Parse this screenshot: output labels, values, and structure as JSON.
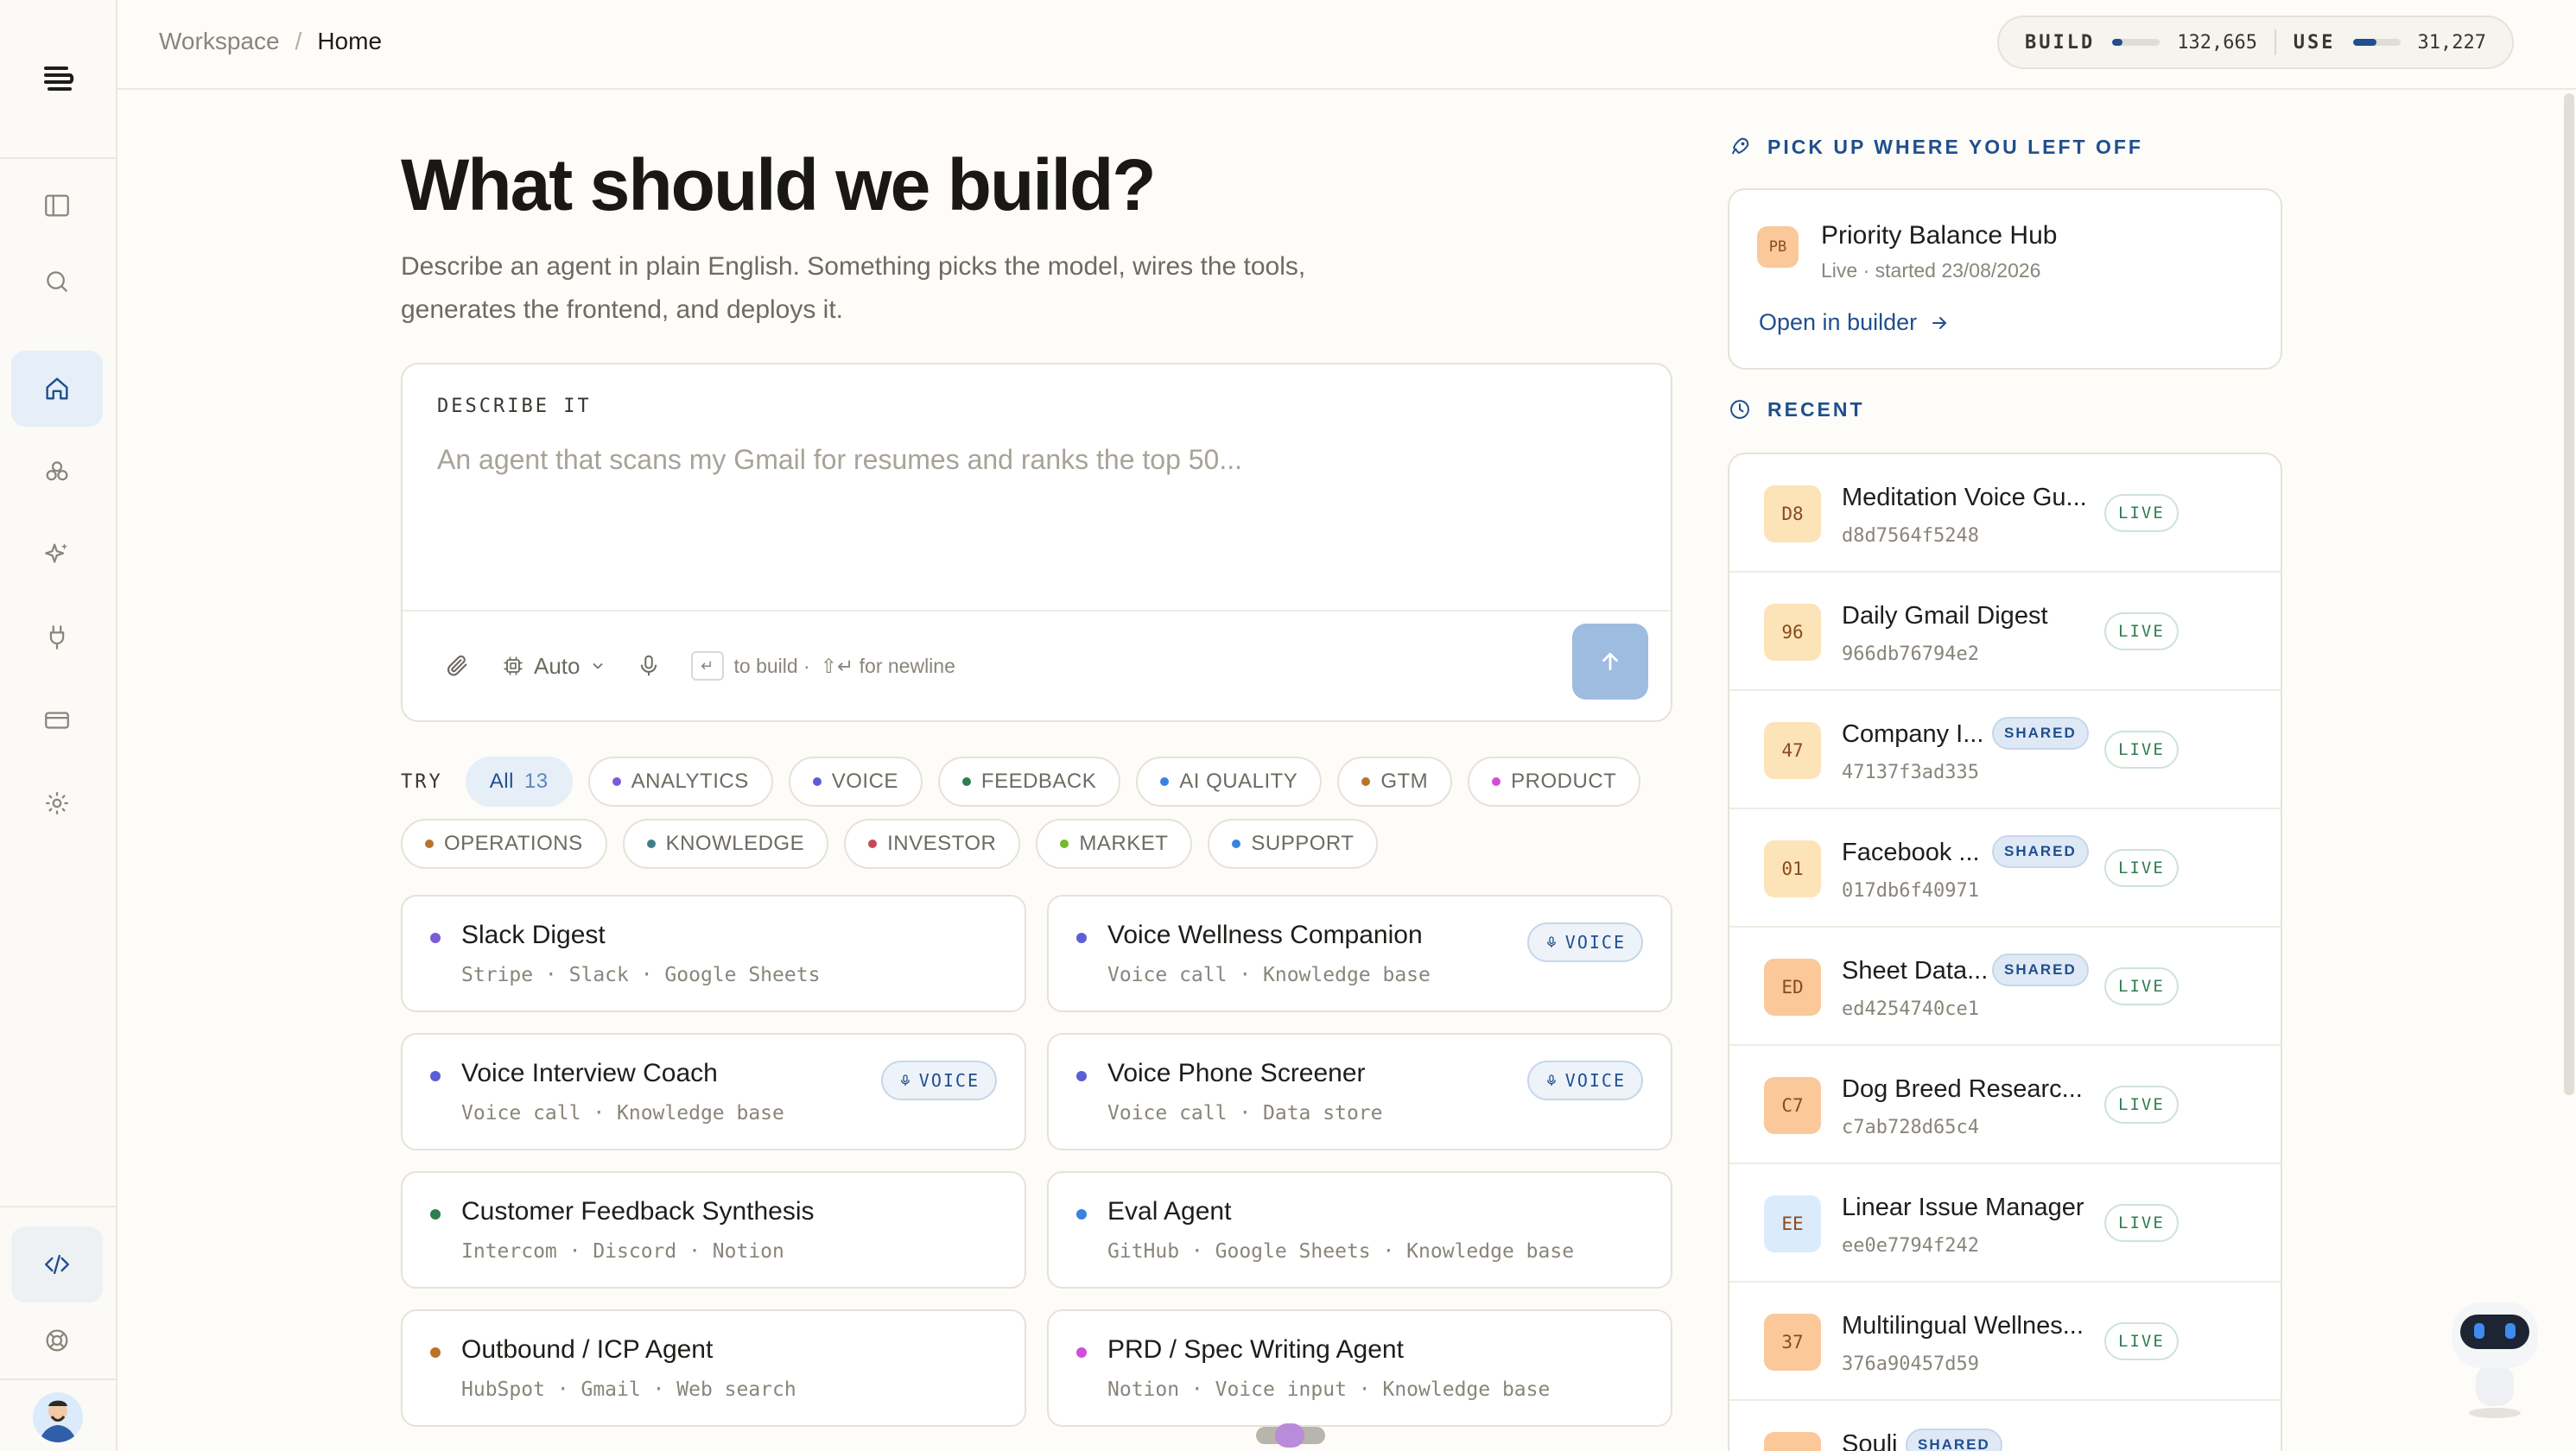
{
  "breadcrumb": {
    "root": "Workspace",
    "separator": "/",
    "current": "Home"
  },
  "usage": {
    "build_label": "BUILD",
    "build_value": "132,665",
    "build_fill": 0.22,
    "use_label": "USE",
    "use_value": "31,227",
    "use_fill": 0.5
  },
  "rail": {
    "items": [
      "sidebar-toggle-icon",
      "search-icon",
      "home-icon",
      "agents-icon",
      "sparkles-icon",
      "plug-icon",
      "billing-icon",
      "settings-icon"
    ],
    "bottom": [
      "code-icon",
      "help-icon",
      "avatar"
    ]
  },
  "hero": {
    "title": "What should we build?",
    "subtitle": "Describe an agent in plain English. Something picks the model, wires the tools, generates the frontend, and deploys it."
  },
  "composer": {
    "label": "DESCRIBE IT",
    "placeholder": "An agent that scans my Gmail for resumes and ranks the top 50...",
    "model": "Auto",
    "enter_key": "↵",
    "hint_build": "to build ·",
    "hint_newline": "⇧↵ for newline"
  },
  "try": {
    "label": "TRY",
    "chips": [
      {
        "label": "All",
        "count": "13",
        "active": true
      },
      {
        "label": "ANALYTICS",
        "color": "#7b5cd6"
      },
      {
        "label": "VOICE",
        "color": "#5b5fd6"
      },
      {
        "label": "FEEDBACK",
        "color": "#2e7d4f"
      },
      {
        "label": "AI QUALITY",
        "color": "#3b82e0"
      },
      {
        "label": "GTM",
        "color": "#b8742a"
      },
      {
        "label": "PRODUCT",
        "color": "#d14fd6"
      }
    ],
    "chips2": [
      {
        "label": "OPERATIONS",
        "color": "#b8742a"
      },
      {
        "label": "KNOWLEDGE",
        "color": "#3f7f8c"
      },
      {
        "label": "INVESTOR",
        "color": "#c44a5a"
      },
      {
        "label": "MARKET",
        "color": "#7ab82a"
      },
      {
        "label": "SUPPORT",
        "color": "#3b82e0"
      }
    ]
  },
  "templates": [
    {
      "name": "Slack Digest",
      "tools": "Stripe · Slack · Google Sheets",
      "color": "#7b5cd6",
      "badge": ""
    },
    {
      "name": "Voice Wellness Companion",
      "tools": "Voice call · Knowledge base",
      "color": "#5b5fd6",
      "badge": "VOICE"
    },
    {
      "name": "Voice Interview Coach",
      "tools": "Voice call · Knowledge base",
      "color": "#5b5fd6",
      "badge": "VOICE"
    },
    {
      "name": "Voice Phone Screener",
      "tools": "Voice call · Data store",
      "color": "#5b5fd6",
      "badge": "VOICE"
    },
    {
      "name": "Customer Feedback Synthesis",
      "tools": "Intercom · Discord · Notion",
      "color": "#2e7d4f",
      "badge": ""
    },
    {
      "name": "Eval Agent",
      "tools": "GitHub · Google Sheets · Knowledge base",
      "color": "#3b82e0",
      "badge": ""
    },
    {
      "name": "Outbound / ICP Agent",
      "tools": "HubSpot · Gmail · Web search",
      "color": "#b8742a",
      "badge": ""
    },
    {
      "name": "PRD / Spec Writing Agent",
      "tools": "Notion · Voice input · Knowledge base",
      "color": "#d14fd6",
      "badge": ""
    }
  ],
  "resume": {
    "heading": "PICK UP WHERE YOU LEFT OFF",
    "initials": "PB",
    "name": "Priority Balance Hub",
    "status": "Live · started 23/08/2026",
    "open_label": "Open in builder"
  },
  "recent": {
    "heading": "RECENT",
    "items": [
      {
        "initials": "D8",
        "name": "Meditation Voice Gu...",
        "hash": "d8d7564f5248",
        "shared": false,
        "status": "LIVE",
        "bg": "#fde3b8"
      },
      {
        "initials": "96",
        "name": "Daily Gmail Digest",
        "hash": "966db76794e2",
        "shared": false,
        "status": "LIVE",
        "bg": "#fde3b8"
      },
      {
        "initials": "47",
        "name": "Company I...",
        "hash": "47137f3ad335",
        "shared": true,
        "status": "LIVE",
        "bg": "#fde3b8"
      },
      {
        "initials": "01",
        "name": "Facebook ...",
        "hash": "017db6f40971",
        "shared": true,
        "status": "LIVE",
        "bg": "#fde3b8"
      },
      {
        "initials": "ED",
        "name": "Sheet Data...",
        "hash": "ed4254740ce1",
        "shared": true,
        "status": "LIVE",
        "bg": "#fbc89a"
      },
      {
        "initials": "C7",
        "name": "Dog Breed Researc...",
        "hash": "c7ab728d65c4",
        "shared": false,
        "status": "LIVE",
        "bg": "#fbc89a"
      },
      {
        "initials": "EE",
        "name": "Linear Issue Manager",
        "hash": "ee0e7794f242",
        "shared": false,
        "status": "LIVE",
        "bg": "#dcebfb"
      },
      {
        "initials": "37",
        "name": "Multilingual Wellnes...",
        "hash": "376a90457d59",
        "shared": false,
        "status": "LIVE",
        "bg": "#fbc89a"
      },
      {
        "initials": "",
        "name": "Souli",
        "hash": "",
        "shared": true,
        "status": "",
        "bg": "#fbc89a"
      }
    ],
    "shared_label": "SHARED"
  }
}
